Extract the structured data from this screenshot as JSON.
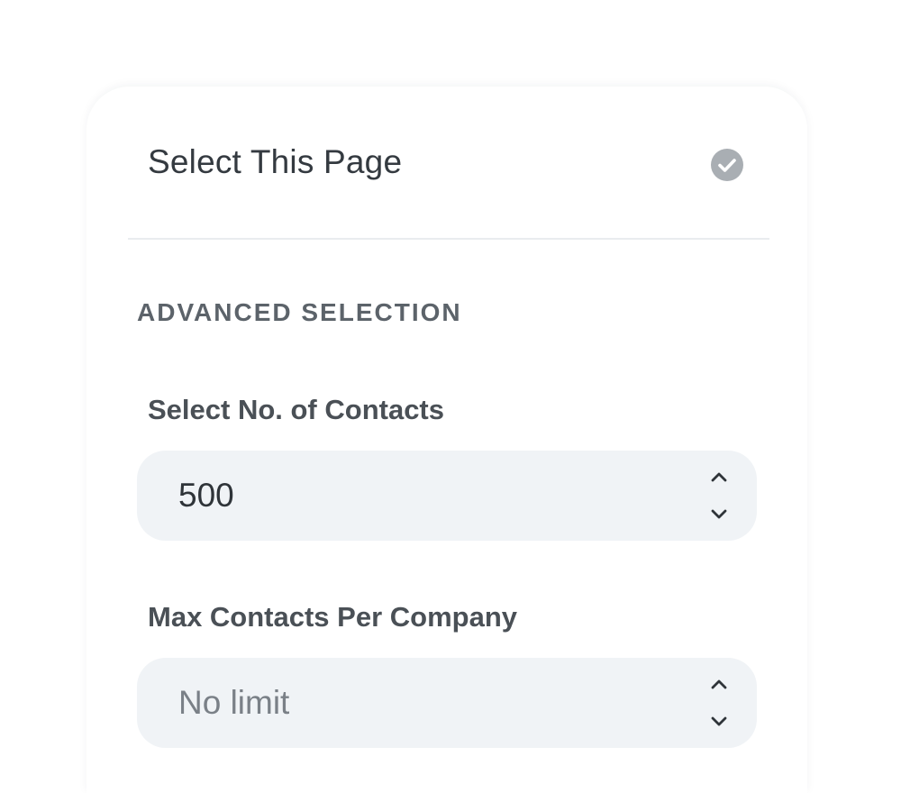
{
  "select_page": {
    "label": "Select This Page",
    "icon": "check-circle-icon",
    "checked": true
  },
  "advanced": {
    "heading": "ADVANCED SELECTION",
    "contacts": {
      "label": "Select No. of Contacts",
      "value": "500",
      "placeholder": ""
    },
    "max_per_company": {
      "label": "Max Contacts Per Company",
      "value": "",
      "placeholder": "No limit"
    }
  },
  "colors": {
    "check_icon": "#a9aeb3",
    "field_background": "#f0f3f6",
    "text_primary": "#343a40",
    "text_muted": "#7a8087"
  }
}
